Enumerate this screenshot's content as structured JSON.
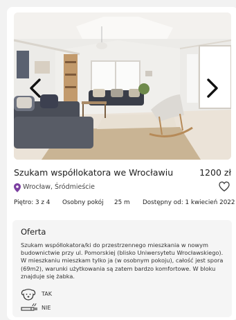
{
  "listing": {
    "title": "Szukam współlokatora we Wrocławiu",
    "price": "1200 zł",
    "location": "Wrocław, Śródmieście",
    "facts": {
      "floor": "Piętro: 3 z 4",
      "room_type": "Osobny pokój",
      "area": "25 m",
      "available": "Dostępny od: 1 kwiecień 2022"
    }
  },
  "offer": {
    "heading": "Oferta",
    "description": "Szukam współlokatora/ki do przestrzennego mieszkania w nowym budownictwie przy ul. Pomorskiej (blisko Uniwersytetu Wrocławskiego). W mieszkaniu mieszkam tylko ja (w osobnym pokoju), całość jest spora (69m2), warunki użytkowania są zatem bardzo komfortowe. W bloku znajduje się żabka.",
    "features": [
      {
        "icon": "dog-icon",
        "value": "TAK"
      },
      {
        "icon": "smoking-icon",
        "value": "NIE"
      }
    ]
  },
  "colors": {
    "pin": "#7b3fa0",
    "background": "#f2f2f2",
    "card": "#ffffff",
    "offer_box": "#f5f5f5"
  },
  "icons": [
    "chevron-left-icon",
    "chevron-right-icon",
    "location-pin-icon",
    "heart-icon",
    "dog-icon",
    "smoking-icon"
  ]
}
